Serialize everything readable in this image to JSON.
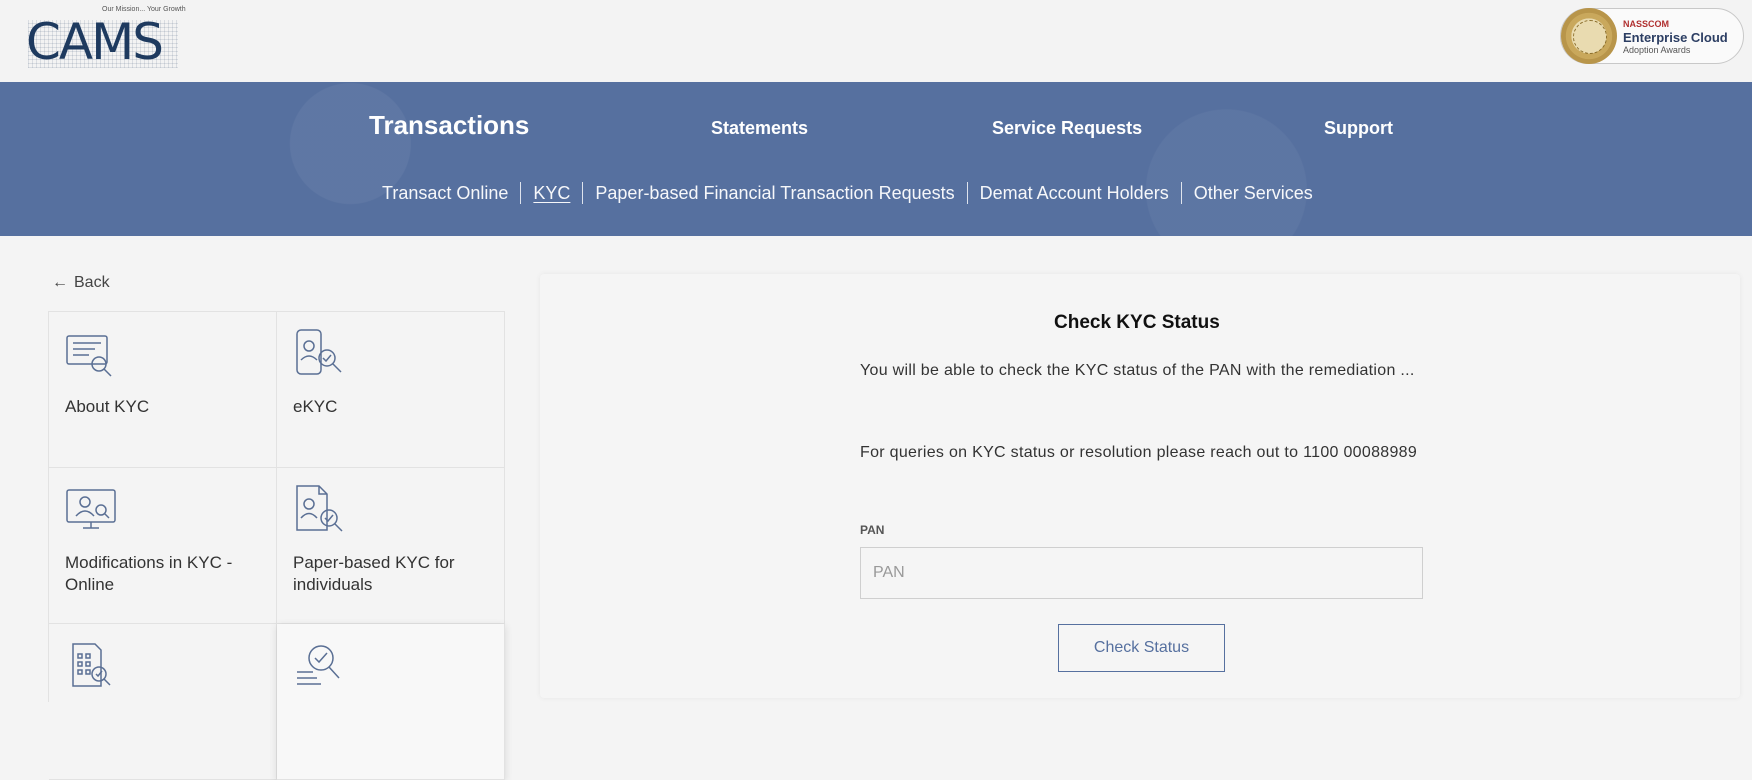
{
  "header": {
    "logo_tagline": "Our Mission... Your Growth",
    "logo_text": "CAMS",
    "award": {
      "brand": "NASSCOM",
      "title": "Enterprise Cloud",
      "subtitle": "Adoption Awards"
    }
  },
  "nav": {
    "main": [
      {
        "label": "Transactions",
        "active": true
      },
      {
        "label": "Statements"
      },
      {
        "label": "Service Requests"
      },
      {
        "label": "Support"
      }
    ],
    "sub": [
      {
        "label": "Transact Online"
      },
      {
        "label": "KYC",
        "current": true
      },
      {
        "label": "Paper-based Financial Transaction Requests"
      },
      {
        "label": "Demat Account Holders"
      },
      {
        "label": "Other Services"
      }
    ]
  },
  "sidebar": {
    "back_label": "Back",
    "tiles": [
      {
        "label": "About KYC",
        "icon": "certificate-search-icon"
      },
      {
        "label": "eKYC",
        "icon": "mobile-verify-icon"
      },
      {
        "label": "Modifications in KYC - Online",
        "icon": "monitor-user-icon"
      },
      {
        "label": "Paper-based KYC for individuals",
        "icon": "document-user-icon"
      },
      {
        "label": "",
        "icon": "building-verify-icon"
      },
      {
        "label": "",
        "icon": "check-status-icon"
      }
    ]
  },
  "kyc_check": {
    "title": "Check KYC Status",
    "description": "You will be able to check the KYC status of the PAN with the remediation ...",
    "queries": "For queries on KYC status or resolution please reach out to 1100 00088989",
    "pan_label": "PAN",
    "pan_placeholder": "PAN",
    "pan_value": "",
    "button_label": "Check Status"
  },
  "colors": {
    "nav_bg": "#56709f",
    "accent": "#56709f",
    "logo": "#1e3a5f"
  }
}
